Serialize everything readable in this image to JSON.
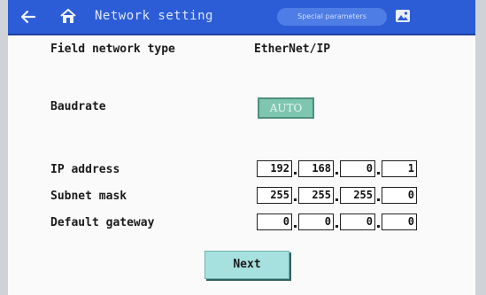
{
  "header": {
    "title": "Network setting",
    "special_label": "Special parameters",
    "back_icon": "back-arrow-icon",
    "home_icon": "home-icon",
    "image_icon": "image-icon"
  },
  "fields": {
    "network_type_label": "Field network type",
    "network_type_value": "EtherNet/IP",
    "baudrate_label": "Baudrate",
    "baudrate_value": "AUTO",
    "ip_label": "IP address",
    "ip": [
      "192",
      "168",
      "0",
      "1"
    ],
    "subnet_label": "Subnet mask",
    "subnet": [
      "255",
      "255",
      "255",
      "0"
    ],
    "gateway_label": "Default gateway",
    "gateway": [
      "0",
      "0",
      "0",
      "0"
    ]
  },
  "actions": {
    "next_label": "Next"
  },
  "colors": {
    "titlebar": "#2c5dd6",
    "auto_button": "#7fc6b0",
    "next_button": "#a7e1df"
  }
}
